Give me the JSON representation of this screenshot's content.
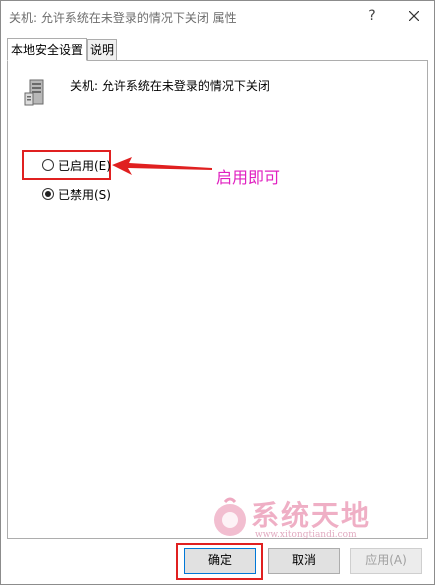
{
  "window": {
    "title": "关机: 允许系统在未登录的情况下关闭 属性",
    "help_label": "?",
    "close_icon": "close-icon"
  },
  "tabs": [
    {
      "label": "本地安全设置",
      "active": true
    },
    {
      "label": "说明",
      "active": false
    }
  ],
  "policy": {
    "icon": "server-icon",
    "title": "关机: 允许系统在未登录的情况下关闭"
  },
  "options": {
    "enabled_label": "已启用(E)",
    "enabled_checked": false,
    "disabled_label": "已禁用(S)",
    "disabled_checked": true
  },
  "annotation": {
    "text": "启用即可",
    "color": "#e020c0",
    "arrow_color": "#e02020"
  },
  "watermark": {
    "title": "系统天地",
    "url": "www.xitongtiandi.com"
  },
  "buttons": {
    "ok": "确定",
    "cancel": "取消",
    "apply": "应用(A)",
    "apply_enabled": false
  },
  "colors": {
    "highlight": "#e02020",
    "accent": "#0078d7"
  }
}
